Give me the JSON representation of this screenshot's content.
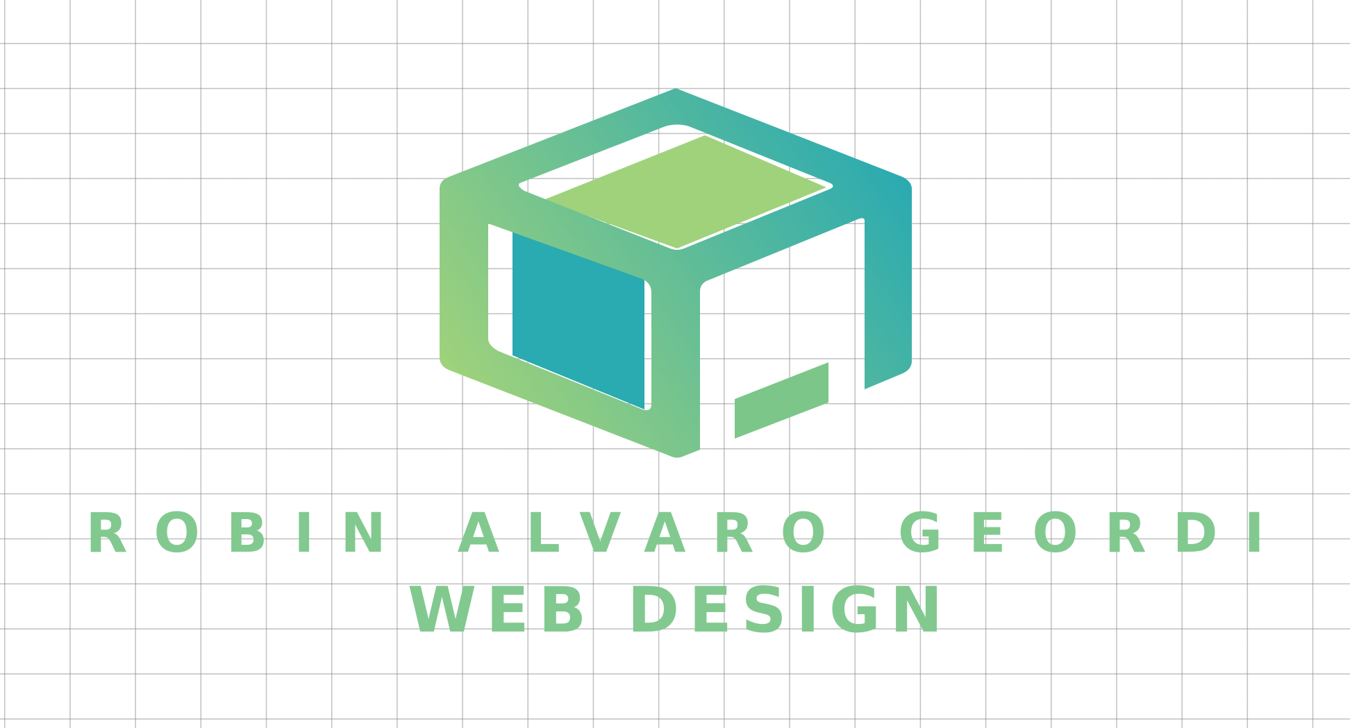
{
  "brand": {
    "name": "ROBIN ALVARO GEORDI",
    "tagline": "WEB DESIGN"
  },
  "logo": {
    "icon": "isometric-cube-logo-icon"
  },
  "colors": {
    "text": "#82c98f",
    "teal": "#2aaab1",
    "green": "#9fd27b",
    "grid": "#8c8c8c",
    "background": "#ffffff"
  }
}
